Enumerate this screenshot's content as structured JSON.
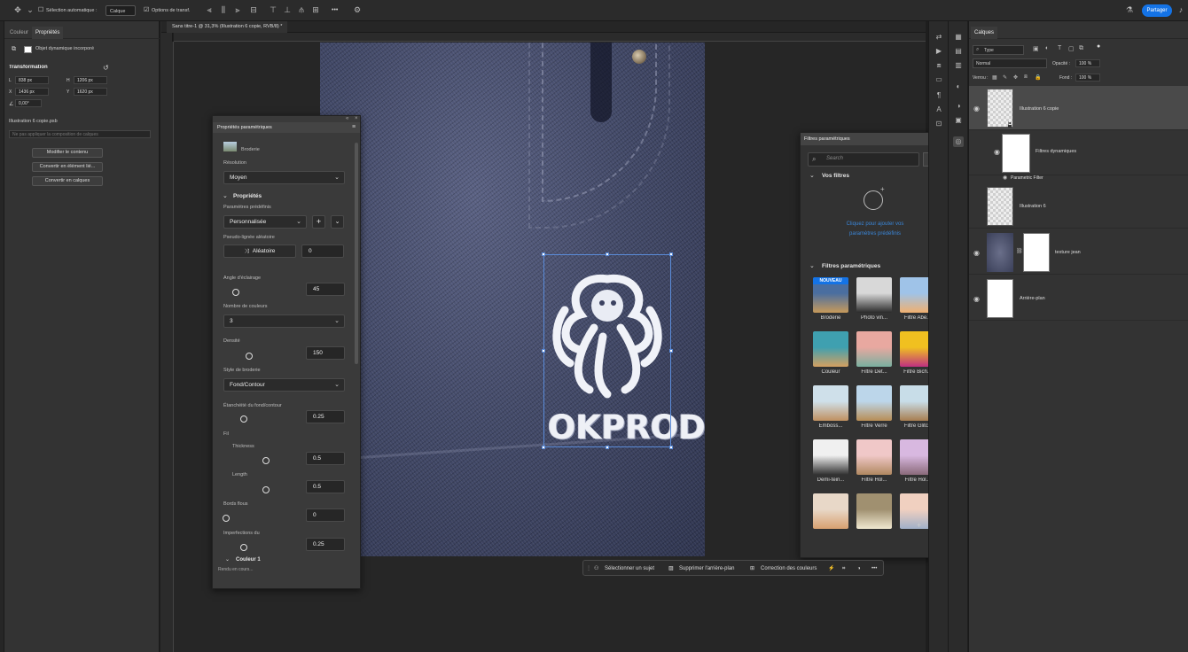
{
  "optbar": {
    "auto_select": "Sélection automatique :",
    "auto_select_value": "Calque",
    "transform_options": "Options de transf.",
    "more": "•••",
    "share": "Partager"
  },
  "props_panel": {
    "tabs": [
      "Couleur",
      "Propriétés"
    ],
    "object_type": "Objet dynamique incorporé",
    "transform_title": "Transformation",
    "L": "L",
    "L_val": "838 px",
    "H": "H",
    "H_val": "1206 px",
    "X": "X",
    "X_val": "1436 px",
    "Y": "Y",
    "Y_val": "1620 px",
    "angle": "0,00°",
    "file_name": "Illustration 6 copie.psb",
    "placeholder": "Ne pas appliquer la composition de calques",
    "btn_contour": "Modifier le contenu",
    "btn_convert_link": "Convertir en élément lié...",
    "btn_convert_layers": "Convertir en calques"
  },
  "doc": {
    "tab_title": "Sans titre-1 @ 31,3% (Illustration 6 copie, RVB/8) *",
    "logo_text": "OKPROD"
  },
  "param_panel": {
    "title": "Propriétés paramétriques",
    "filter_name": "Broderie",
    "resolution_label": "Résolution",
    "resolution_value": "Moyen",
    "props_section": "Propriétés",
    "presets_label": "Paramètres prédéfinis",
    "presets_value": "Personnalisée",
    "seed_label": "Pseudo-lignée aléatoire",
    "random_btn": "Aléatoire",
    "seed_value": "0",
    "angle_label": "Angle d'éclairage",
    "angle_value": "45",
    "colors_label": "Nombre de couleurs",
    "colors_value": "3",
    "density_label": "Densité",
    "density_value": "150",
    "style_label": "Style de broderie",
    "style_value": "Fond/Contour",
    "contour_label": "Étanchéité du fond/contour",
    "contour_value": "0.25",
    "fil_label": "Fil",
    "thickness_label": "Thickness",
    "thickness_value": "0.5",
    "length_label": "Length",
    "length_value": "0.5",
    "border_label": "Bords flous",
    "border_value": "0",
    "imperf_label": "Imperfections du",
    "imperf_value": "0.25",
    "color1_section": "Couleur 1",
    "status": "Rendu en cours..."
  },
  "filters": {
    "title": "Filtres paramétriques",
    "search_placeholder": "Search",
    "your_filters": "Vos filtres",
    "create_link": "Cliquez pour ajouter vos paramètres prédéfinis",
    "param_filters": "Filtres paramétriques",
    "badge": "NOUVEAU",
    "items": [
      {
        "name": "Broderie",
        "c1": "#4a6ea0",
        "c2": "#c79a5a"
      },
      {
        "name": "Photo vin...",
        "c1": "#d8d8d8",
        "c2": "#2a2a2a"
      },
      {
        "name": "Filtre Abe...",
        "c1": "#9fc3e8",
        "c2": "#f0b070"
      },
      {
        "name": "Couleur",
        "c1": "#3fa0b0",
        "c2": "#d4a060"
      },
      {
        "name": "Filtre Det...",
        "c1": "#e8a8a0",
        "c2": "#7ab0a0"
      },
      {
        "name": "Filtre Bich...",
        "c1": "#f0c020",
        "c2": "#c03080"
      },
      {
        "name": "Emboss...",
        "c1": "#cfe0ea",
        "c2": "#c09060"
      },
      {
        "name": "Filtre Verre",
        "c1": "#bcd6ea",
        "c2": "#b88d55"
      },
      {
        "name": "Filtre Glitch",
        "c1": "#c8dde8",
        "c2": "#a87e50"
      },
      {
        "name": "Demi-tein...",
        "c1": "#f0f0f0",
        "c2": "#303030"
      },
      {
        "name": "Filtre Hol...",
        "c1": "#f0c8c8",
        "c2": "#b08860"
      },
      {
        "name": "Filtre Hol...",
        "c1": "#d8b8e0",
        "c2": "#8a6a7a"
      },
      {
        "name": "",
        "c1": "#e8d8c8",
        "c2": "#d8a070"
      },
      {
        "name": "",
        "c1": "#a09070",
        "c2": "#f0e8d0"
      },
      {
        "name": "",
        "c1": "#f0d0c0",
        "c2": "#a0b0c8"
      }
    ]
  },
  "layers": {
    "tab": "Calques",
    "kind": "Type",
    "blend": "Normal",
    "opacity_label": "Opacité :",
    "opacity_value": "100 %",
    "lock_label": "Verrou :",
    "fill_label": "Fond :",
    "fill_value": "100 %",
    "rows": [
      "Illustration 6 copie",
      "Filtres dynamiques",
      "Parametric Filter",
      "Illustration 6",
      "texture jean",
      "Arrière-plan"
    ]
  },
  "ctx_bar": {
    "select_subject": "Sélectionner un sujet",
    "remove_bg": "Supprimer l'arrière-plan",
    "color_correction": "Correction des couleurs"
  }
}
